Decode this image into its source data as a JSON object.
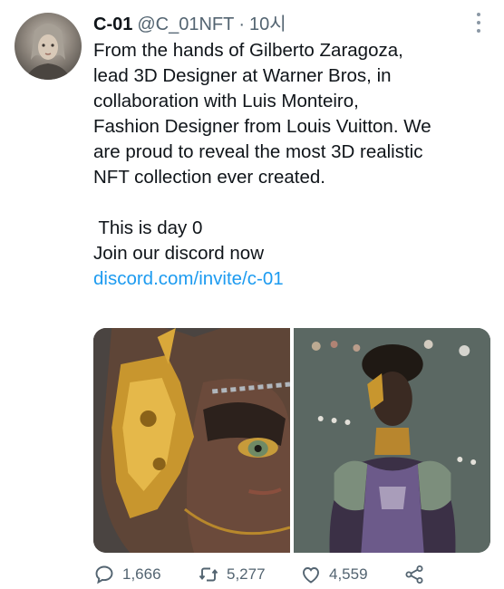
{
  "tweet": {
    "author_name": "C-01",
    "handle": "@C_01NFT",
    "separator": "·",
    "time": "10시",
    "body_lines": [
      "From the hands of Gilberto Zaragoza,",
      "lead 3D Designer at Warner Bros, in",
      "collaboration with Luis Monteiro,",
      "Fashion Designer from Louis Vuitton. We",
      "are proud to reveal the most 3D realistic",
      "NFT collection ever created."
    ],
    "line_day": " This is day 0",
    "line_discord": "Join our discord now",
    "link": "discord.com/invite/c-01"
  },
  "actions": {
    "replies": "1,666",
    "retweets": "5,277",
    "likes": "4,559"
  },
  "icons": {
    "more": "more-icon",
    "reply": "reply-icon",
    "retweet": "retweet-icon",
    "like": "heart-icon",
    "share": "share-icon"
  },
  "colors": {
    "text": "#0f1419",
    "secondary": "#536471",
    "link": "#1d9bf0"
  }
}
